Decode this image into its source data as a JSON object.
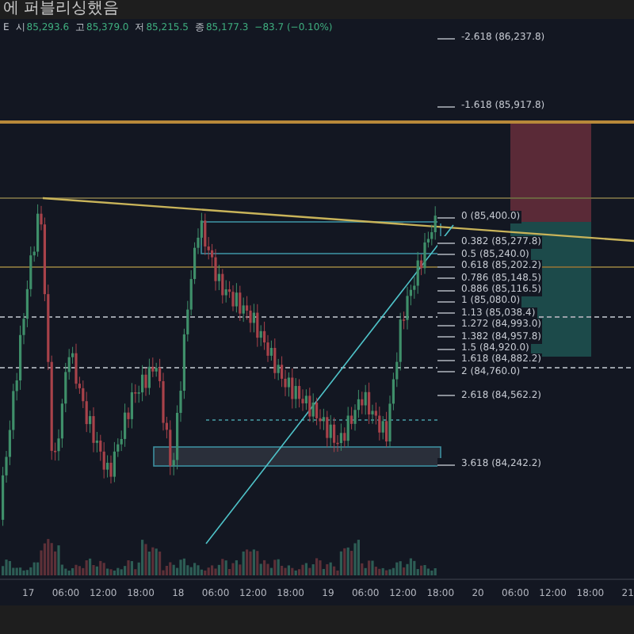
{
  "header": {
    "title": "에 퍼블리싱했음"
  },
  "legend": {
    "symbol": "E",
    "fields": [
      {
        "label": "시",
        "value": "85,293.6"
      },
      {
        "label": "고",
        "value": "85,379.0"
      },
      {
        "label": "저",
        "value": "85,215.5"
      },
      {
        "label": "종",
        "value": "85,177.3"
      }
    ],
    "change": "−83.7 (−0.10%)"
  },
  "fib_levels": [
    "-2.618 (86,237.8)",
    "-1.618 (85,917.8)",
    "0 (85,400.0)",
    "0.382 (85,277.8)",
    "0.5 (85,240.0)",
    "0.618 (85,202.2)",
    "0.786 (85,148.5)",
    "0.886 (85,116.5)",
    "1 (85,080.0)",
    "1.13 (85,038.4)",
    "1.272 (84,993.0)",
    "1.382 (84,957.8)",
    "1.5 (84,920.0)",
    "1.618 (84,882.2)",
    "2 (84,760.0)",
    "2.618 (84,562.2)",
    "3.618 (84,242.2)"
  ],
  "time_axis": [
    "17",
    "06:00",
    "12:00",
    "18:00",
    "18",
    "06:00",
    "12:00",
    "18:00",
    "19",
    "06:00",
    "12:00",
    "18:00",
    "20",
    "06:00",
    "12:00",
    "18:00",
    "21"
  ]
}
